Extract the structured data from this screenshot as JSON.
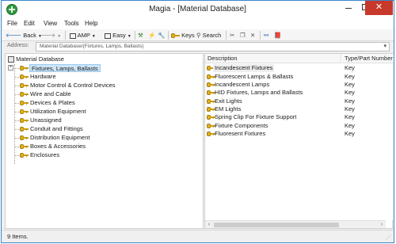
{
  "window": {
    "title": "Magia - [Material Database]"
  },
  "menu": [
    "File",
    "Edit",
    "View",
    "Tools",
    "Help"
  ],
  "toolbar": {
    "back_label": "Back",
    "amp_label": "AMP",
    "easy_label": "Easy",
    "keys_label": "Keys",
    "search_label": "Search"
  },
  "address": {
    "label": "Address:",
    "value": "Material Database/(Fixtures, Lamps, Ballasts)"
  },
  "tree": {
    "root": "Material Database",
    "items": [
      "Fixtures, Lamps, Ballasts",
      "Hardware",
      "Motor Control & Control Devices",
      "Wire and Cable",
      "Devices & Plates",
      "Utilization Equipment",
      "Unassigned",
      "Conduit and Fittings",
      "Distribution Equipment",
      "Boxes & Accessories",
      "Enclosures"
    ],
    "selected_index": 0
  },
  "list": {
    "columns": [
      "Description",
      "Type/Part Number"
    ],
    "rows": [
      {
        "description": "Incandescent Fixtures",
        "type": "Key"
      },
      {
        "description": "Fluorescent Lamps & Ballasts",
        "type": "Key"
      },
      {
        "description": "Incandescent Lamps",
        "type": "Key"
      },
      {
        "description": "HID Fixtures, Lamps and Ballasts",
        "type": "Key"
      },
      {
        "description": "Exit Lights",
        "type": "Key"
      },
      {
        "description": "EM Lights",
        "type": "Key"
      },
      {
        "description": "Spring Clip For Fixture Support",
        "type": "Key"
      },
      {
        "description": "Fixture Components",
        "type": "Key"
      },
      {
        "description": "Fluoresent Fixtures",
        "type": "Key"
      }
    ]
  },
  "status": {
    "text": "9 Items."
  },
  "colors": {
    "accent": "#3a86c8",
    "close": "#c7392b",
    "key_icon": "#e3b11a",
    "selection": "#cce4f7"
  }
}
